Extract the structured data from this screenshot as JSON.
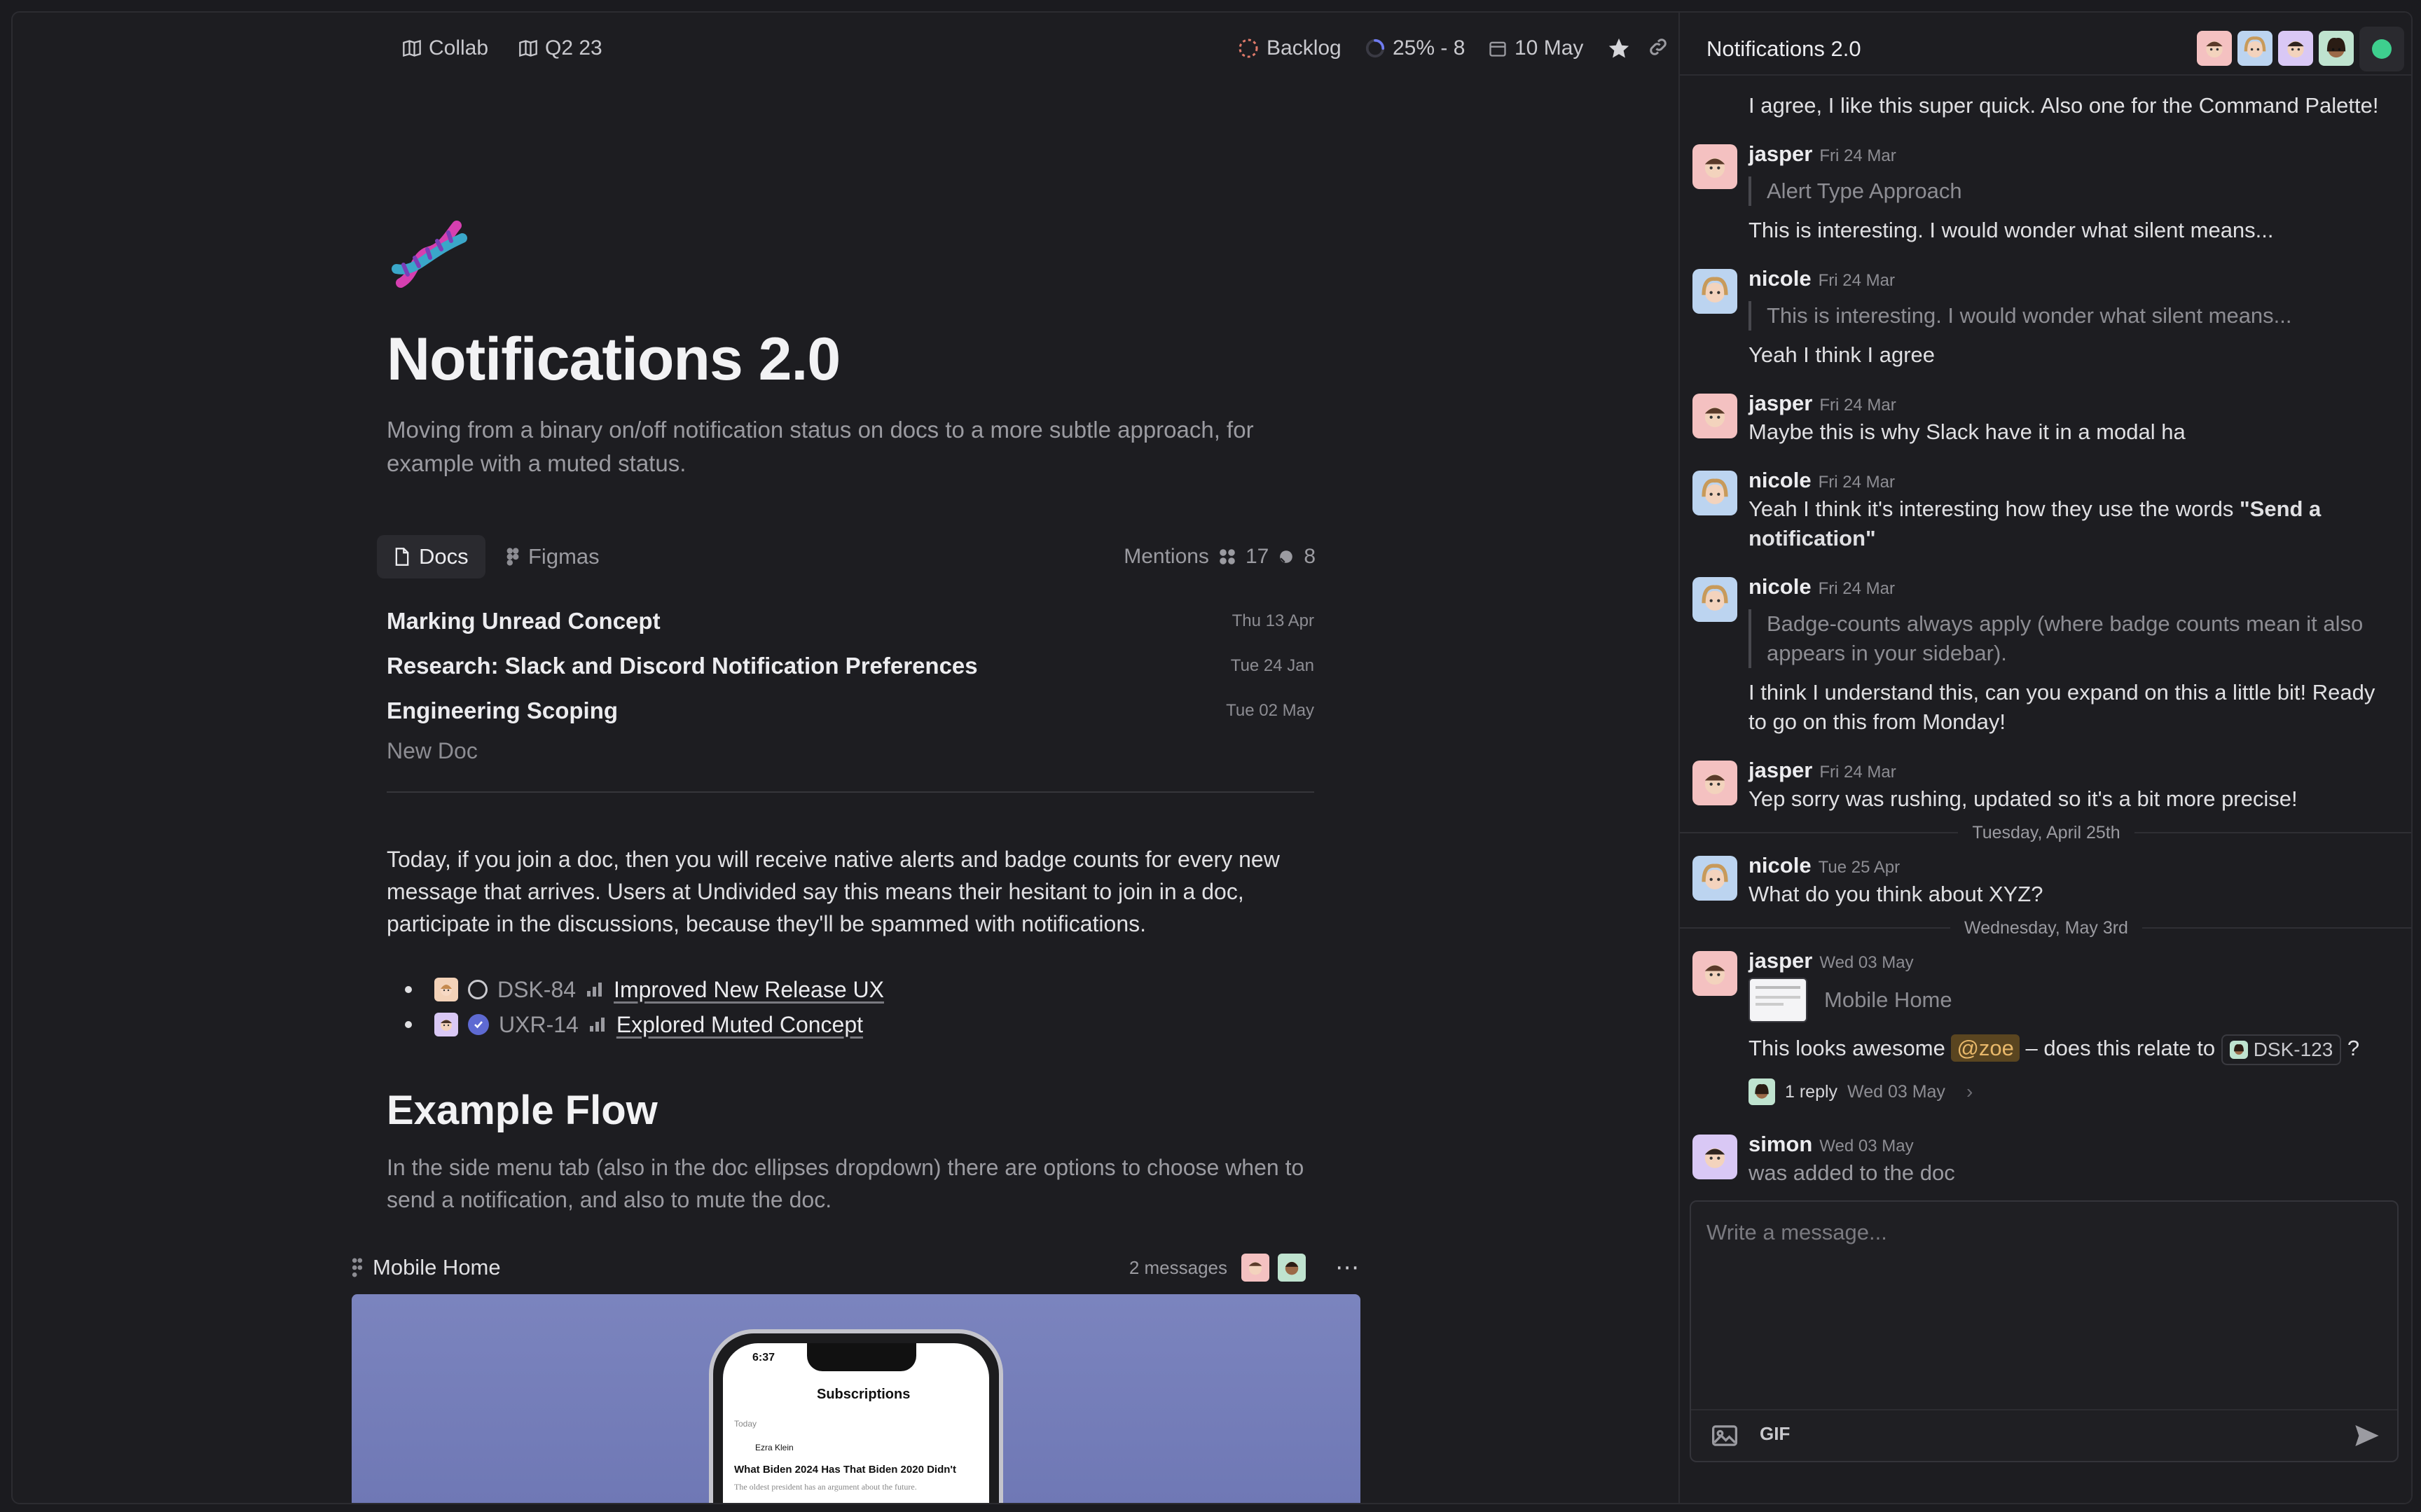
{
  "topbar": {
    "crumbs": [
      "Collab",
      "Q2 23"
    ],
    "status": "Backlog",
    "progress": "25% - 8",
    "progress_fraction": 0.25,
    "due_date": "10 May"
  },
  "doc": {
    "title": "Notifications 2.0",
    "subtitle": "Moving from a binary on/off notification status on docs to a more subtle approach, for example with a muted status.",
    "tabs": [
      {
        "label": "Docs"
      },
      {
        "label": "Figmas"
      }
    ],
    "mentions": {
      "label": "Mentions",
      "figma_count": "17",
      "linear_count": "8"
    },
    "docs": [
      {
        "title": "Marking Unread Concept",
        "date": "Thu 13 Apr"
      },
      {
        "title": "Research: Slack and Discord Notification Preferences",
        "date": "Tue 24 Jan"
      },
      {
        "title": "Engineering Scoping",
        "date": "Tue 02 May"
      }
    ],
    "new_doc": "New Doc",
    "para1": "Today, if you join a doc, then you will receive native alerts and badge counts for every new message that arrives.  Users at Undivided say this means their hesitant to join in a doc, participate in the discussions, because they'll be spammed with notifications.",
    "issues": [
      {
        "id": "DSK-84",
        "title": "Improved New Release UX"
      },
      {
        "id": "UXR-14",
        "title": "Explored Muted Concept"
      }
    ],
    "section_heading": "Example Flow",
    "section_para": "In the side menu tab (also in the doc ellipses dropdown) there are options to choose when to send a notification, and also to mute the doc.",
    "figma": {
      "name": "Mobile Home",
      "messages": "2 messages",
      "phone_time": "6:37",
      "phone_title": "Subscriptions",
      "phone_section": "Today",
      "phone_author": "Ezra Klein",
      "phone_headline": "What Biden 2024 Has That Biden 2020 Didn't",
      "phone_sub": "The oldest president has an argument about the future."
    }
  },
  "sidebar": {
    "title": "Notifications 2.0",
    "messages": [
      {
        "text": "I agree, I like this super quick. Also one for the Command Palette!"
      },
      {
        "author": "jasper",
        "date": "Fri 24 Mar",
        "quote": "Alert Type Approach",
        "text": "This is interesting. I would wonder what silent means..."
      },
      {
        "author": "nicole",
        "date": "Fri 24 Mar",
        "quote": "This is interesting. I would wonder what silent means...",
        "text": "Yeah I think I agree"
      },
      {
        "author": "jasper",
        "date": "Fri 24 Mar",
        "text": "Maybe this is why Slack have it in a modal ha"
      },
      {
        "author": "nicole",
        "date": "Fri 24 Mar",
        "text_a": "Yeah I think it's interesting how they use the words ",
        "text_b": "\"Send a notification\""
      },
      {
        "author": "nicole",
        "date": "Fri 24 Mar",
        "quote": "Badge-counts always apply (where badge counts mean it also appears in your sidebar).",
        "text": "I think I understand this, can you expand on this a little bit! Ready to go on this from Monday!"
      },
      {
        "author": "jasper",
        "date": "Fri 24 Mar",
        "text": "Yep sorry was rushing, updated so it's a bit more precise!"
      },
      {
        "author": "nicole",
        "date": "Tue 25 Apr",
        "text": "What do you think about XYZ?"
      },
      {
        "author": "jasper",
        "date": "Wed 03 May",
        "attachment": "Mobile Home",
        "text_a": "This looks awesome ",
        "mention": "@zoe",
        "text_b": " – does this relate to ",
        "issue": "DSK-123",
        "text_c": " ?",
        "reply_count": "1 reply",
        "reply_date": "Wed 03 May"
      },
      {
        "author": "simon",
        "date": "Wed 03 May",
        "text": "was added to the doc"
      }
    ],
    "separators": [
      "Tuesday, April 25th",
      "Wednesday, May 3rd"
    ],
    "composer": {
      "placeholder": "Write a message...",
      "gif_label": "GIF"
    }
  },
  "colors": {
    "accent": "#5e6ad2",
    "online": "#3ecf8e",
    "mention_bg": "#5a4520",
    "mention_fg": "#e8b86a",
    "avatar_jasper": "#f4c1c1",
    "avatar_nicole": "#bcd4f0",
    "avatar_simon": "#d9c8f5"
  }
}
